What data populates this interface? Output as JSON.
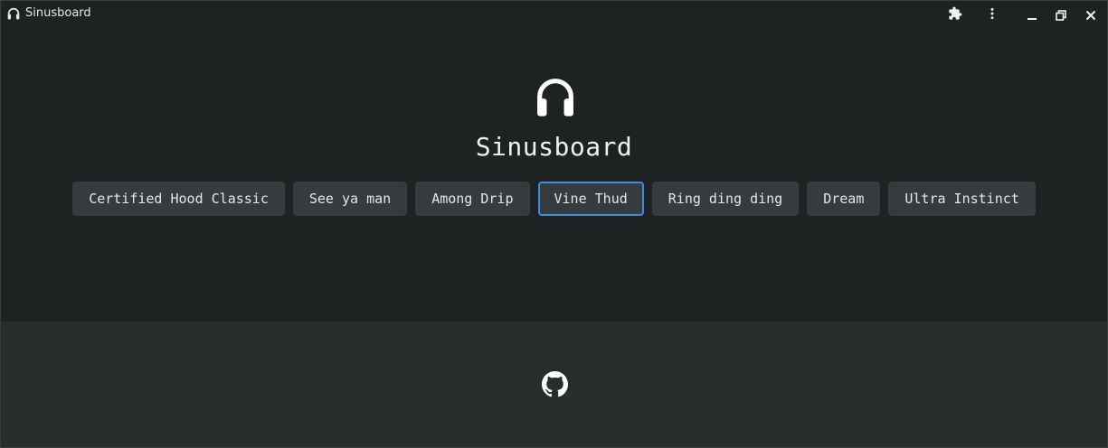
{
  "window": {
    "title": "Sinusboard",
    "icons": {
      "app": "headphones-icon",
      "extensions": "puzzle-icon",
      "menu": "kebab-menu-icon",
      "minimize": "minimize-icon",
      "restore": "restore-icon",
      "close": "close-icon"
    }
  },
  "main": {
    "hero_icon": "headphones-icon",
    "title": "Sinusboard",
    "sounds": [
      {
        "label": "Certified Hood Classic"
      },
      {
        "label": "See ya man"
      },
      {
        "label": "Among Drip"
      },
      {
        "label": "Vine Thud",
        "active": true
      },
      {
        "label": "Ring ding ding"
      },
      {
        "label": "Dream"
      },
      {
        "label": "Ultra Instinct"
      }
    ]
  },
  "footer": {
    "icon": "github-icon"
  },
  "colors": {
    "background": "#1f2223",
    "footer_background": "#282d2e",
    "button_background": "#363b3d",
    "focus_accent": "#3b8ee0",
    "text": "#e6e6e6"
  }
}
